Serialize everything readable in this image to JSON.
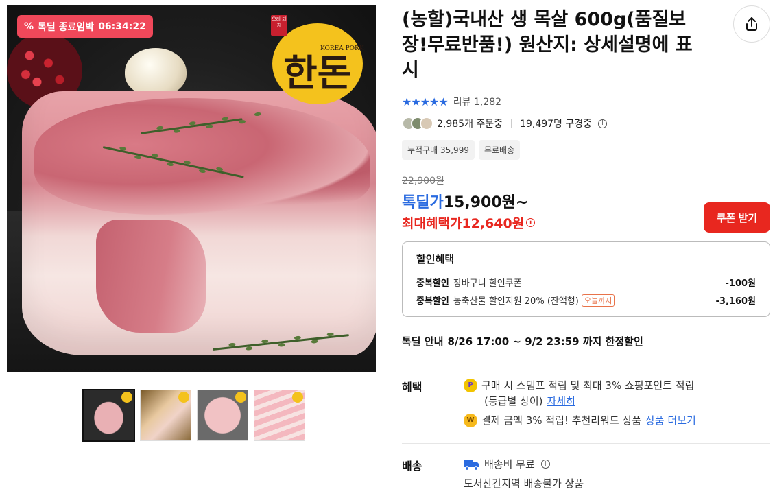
{
  "deal_badge": {
    "icon": "percent-icon",
    "label": "톡딜 종료임박",
    "timer": "06:34:22"
  },
  "brand": {
    "tag": "오리 돼지",
    "korea_pork": "KOREA PORK",
    "mark": "한돈"
  },
  "product": {
    "title": "(농할)국내산 생 목살 600g(품질보장!무료반품!) 원산지: 상세설명에 표시",
    "rating_stars": "★★★★★",
    "review_label": "리뷰 1,282",
    "buying_now": "2,985개 주문중",
    "viewing_now": "19,497명 구경중",
    "chips": [
      "누적구매 35,999",
      "무료배송"
    ]
  },
  "price": {
    "original": "22,900원",
    "deal_label": "톡딜가",
    "deal_value": "15,900원~",
    "max_label": "최대혜택가",
    "max_value": "12,640원",
    "coupon_button": "쿠폰 받기"
  },
  "discount": {
    "heading": "할인혜택",
    "rows": [
      {
        "key": "중복할인",
        "value": "장바구니 할인쿠폰",
        "badge": "",
        "amount": "-100원"
      },
      {
        "key": "중복할인",
        "value": "농축산물 할인지원 20% (잔액형)",
        "badge": "오늘까지",
        "amount": "-3,160원"
      }
    ]
  },
  "notice": {
    "label": "톡딜 안내",
    "text": "8/26 17:00 ~ 9/2 23:59 까지 한정할인"
  },
  "benefit": {
    "label": "혜택",
    "line1": "구매 시 스탬프 적립 및 최대 3% 쇼핑포인트 적립",
    "line1b": "(등급별 상이)",
    "line1_link": "자세히",
    "line2": "결제 금액 3% 적립! 추천리워드 상품",
    "line2_link": "상품 더보기"
  },
  "shipping": {
    "label": "배송",
    "fee": "배송비 무료",
    "note": "도서산간지역 배송불가 상품"
  },
  "colors": {
    "accent_blue": "#2a6be0",
    "accent_red": "#e8271f",
    "badge_pink": "#f0485a"
  }
}
